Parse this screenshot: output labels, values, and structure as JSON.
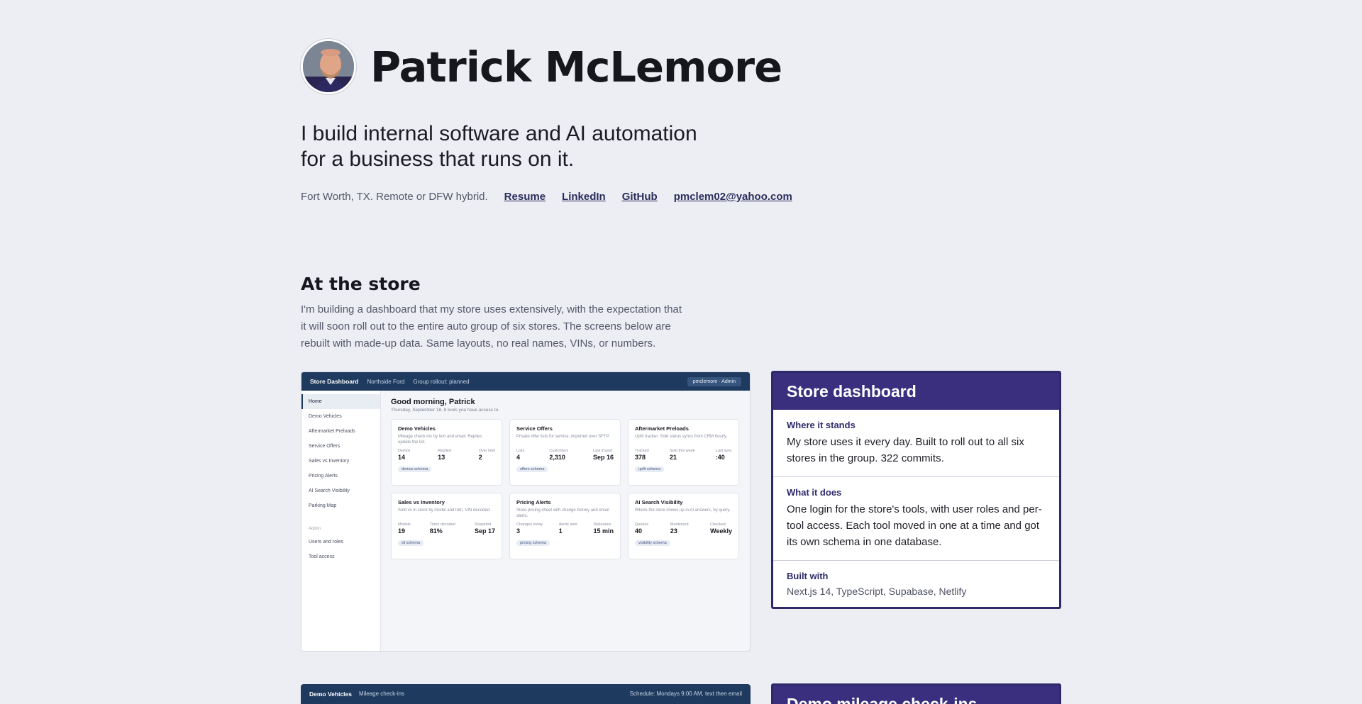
{
  "hero": {
    "name": "Patrick McLemore",
    "tagline": "I build internal software and AI automation for a business that runs on it.",
    "location": "Fort Worth, TX. Remote or DFW hybrid.",
    "links": [
      "Resume",
      "LinkedIn",
      "GitHub",
      "pmclem02@yahoo.com"
    ]
  },
  "section": {
    "title": "At the store",
    "intro": "I'm building a dashboard that my store uses extensively, with the expectation that it will soon roll out to the entire auto group of six stores. The screens below are rebuilt with made-up data. Same layouts, no real names, VINs, or numbers."
  },
  "dashboard": {
    "brand": "Store Dashboard",
    "store": "Northside Ford",
    "rollout": "Group rollout: planned",
    "user": "pmclemore · Admin",
    "nav": [
      "Home",
      "Demo Vehicles",
      "Aftermarket Preloads",
      "Service Offers",
      "Sales vs Inventory",
      "Pricing Alerts",
      "AI Search Visibility",
      "Parking Map"
    ],
    "admin_label": "Admin",
    "admin_nav": [
      "Users and roles",
      "Tool access"
    ],
    "greeting": "Good morning, Patrick",
    "date": "Thursday, September 18. 8 tools you have access to.",
    "cards": [
      {
        "title": "Demo Vehicles",
        "desc": "Mileage check-ins by text and email. Replies update the list.",
        "stats": [
          [
            "Demos",
            "14"
          ],
          [
            "Replied",
            "13"
          ],
          [
            "Over limit",
            "2"
          ]
        ],
        "tag": "demos schema"
      },
      {
        "title": "Service Offers",
        "desc": "Private offer lists for service, imported over SFTP.",
        "stats": [
          [
            "Lists",
            "4"
          ],
          [
            "Customers",
            "2,310"
          ],
          [
            "Last import",
            "Sep 16"
          ]
        ],
        "tag": "offers schema"
      },
      {
        "title": "Aftermarket Preloads",
        "desc": "Upfit tracker. Sold status syncs from CRM hourly.",
        "stats": [
          [
            "Tracked",
            "378"
          ],
          [
            "Sold this week",
            "21"
          ],
          [
            "Last sync",
            ":40"
          ]
        ],
        "tag": "upfit schema"
      },
      {
        "title": "Sales vs Inventory",
        "desc": "Sold vs in stock by model and trim. VIN decoded.",
        "stats": [
          [
            "Models",
            "19"
          ],
          [
            "Trims decoded",
            "81%"
          ],
          [
            "Snapshot",
            "Sep 17"
          ]
        ],
        "tag": "sil schema"
      },
      {
        "title": "Pricing Alerts",
        "desc": "Store pricing sheet with change history and email alerts.",
        "stats": [
          [
            "Changes today",
            "3"
          ],
          [
            "Alerts sent",
            "1"
          ],
          [
            "Debounce",
            "15 min"
          ]
        ],
        "tag": "pricing schema"
      },
      {
        "title": "AI Search Visibility",
        "desc": "Where the store shows up in AI answers, by query.",
        "stats": [
          [
            "Queries",
            "40"
          ],
          [
            "Mentioned",
            "23"
          ],
          [
            "Checked",
            "Weekly"
          ]
        ],
        "tag": "visibility schema"
      }
    ]
  },
  "panel": {
    "title": "Store dashboard",
    "rows": [
      {
        "label": "Where it stands",
        "text": "My store uses it every day. Built to roll out to all six stores in the group. 322 commits."
      },
      {
        "label": "What it does",
        "text": "One login for the store's tools, with user roles and per-tool access. Each tool moved in one at a time and got its own schema in one database."
      },
      {
        "label": "Built with",
        "text": "Next.js 14, TypeScript, Supabase, Netlify"
      }
    ]
  },
  "next_shot": {
    "brand": "Demo Vehicles",
    "sub": "Mileage check-ins",
    "right": "Schedule: Mondays 9:00 AM, text then email"
  },
  "next_panel": {
    "title": "Demo mileage check-ins"
  }
}
